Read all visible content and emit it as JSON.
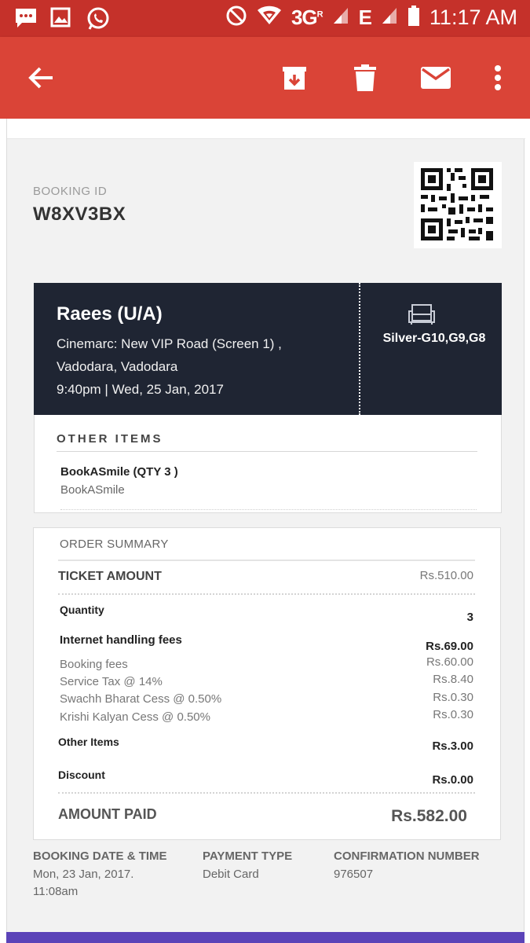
{
  "status_bar": {
    "network": "3G",
    "network_sup": "R",
    "network2": "E",
    "time": "11:17 AM",
    "icons": [
      "messaging-icon",
      "gallery-icon",
      "whatsapp-icon",
      "blocked-icon",
      "wifi-icon",
      "signal-icon",
      "battery-icon"
    ]
  },
  "app_bar": {
    "icons": [
      "back-arrow-icon",
      "archive-icon",
      "delete-icon",
      "mail-icon",
      "more-vert-icon"
    ]
  },
  "booking": {
    "label": "BOOKING ID",
    "id": "W8XV3BX"
  },
  "movie": {
    "title": "Raees (U/A)",
    "venue_line1": "Cinemarc: New VIP Road (Screen 1) ,",
    "venue_line2": "Vadodara, Vadodara",
    "showtime": "9:40pm | Wed, 25 Jan, 2017",
    "seats": "Silver-G10,G9,G8"
  },
  "other_items": {
    "heading": "OTHER ITEMS",
    "item_name": "BookASmile (QTY 3 )",
    "item_sub": "BookASmile"
  },
  "summary": {
    "heading": "ORDER SUMMARY",
    "ticket_label": "TICKET AMOUNT",
    "ticket_value": "Rs.510.00",
    "quantity_label": "Quantity",
    "quantity_value": "3",
    "fees_label": "Internet handling fees",
    "fees_value": "Rs.69.00",
    "fee_rows": [
      {
        "label": "Booking fees",
        "value": "Rs.60.00"
      },
      {
        "label": "Service Tax @ 14%",
        "value": "Rs.8.40"
      },
      {
        "label": "Swachh Bharat Cess @ 0.50%",
        "value": "Rs.0.30"
      },
      {
        "label": "Krishi Kalyan Cess @ 0.50%",
        "value": "Rs.0.30"
      }
    ],
    "other_label": "Other Items",
    "other_value": "Rs.3.00",
    "discount_label": "Discount",
    "discount_value": "Rs.0.00",
    "paid_label": "AMOUNT PAID",
    "paid_value": "Rs.582.00"
  },
  "details": {
    "date_label": "BOOKING DATE & TIME",
    "date_value_line1": "Mon, 23 Jan, 2017.",
    "date_value_line2": "11:08am",
    "payment_label": "PAYMENT TYPE",
    "payment_value": "Debit Card",
    "confirm_label": "CONFIRMATION NUMBER",
    "confirm_value": "976507"
  },
  "colors": {
    "status_bar": "#c5312a",
    "app_bar": "#da4437",
    "movie_card": "#1f2533",
    "bottom_bar": "#5b43b8"
  }
}
